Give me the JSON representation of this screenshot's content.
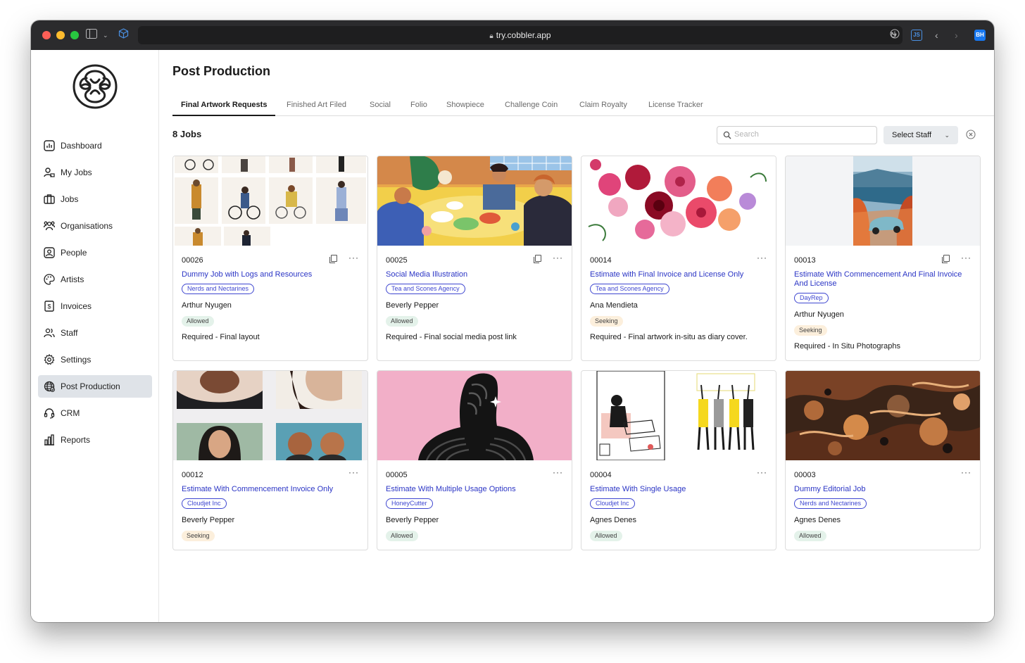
{
  "browser": {
    "url": "try.cobbler.app",
    "extension_js": "JS",
    "extension_bh": "BH"
  },
  "sidebar": {
    "items": [
      {
        "label": "Dashboard",
        "icon": "dashboard-icon"
      },
      {
        "label": "My Jobs",
        "icon": "user-jobs-icon"
      },
      {
        "label": "Jobs",
        "icon": "briefcase-icon"
      },
      {
        "label": "Organisations",
        "icon": "organisations-icon"
      },
      {
        "label": "People",
        "icon": "people-icon"
      },
      {
        "label": "Artists",
        "icon": "palette-icon"
      },
      {
        "label": "Invoices",
        "icon": "invoice-icon"
      },
      {
        "label": "Staff",
        "icon": "staff-icon"
      },
      {
        "label": "Settings",
        "icon": "gear-icon"
      },
      {
        "label": "Post Production",
        "icon": "globe-icon",
        "active": true
      },
      {
        "label": "CRM",
        "icon": "headset-icon"
      },
      {
        "label": "Reports",
        "icon": "bar-chart-icon"
      }
    ]
  },
  "main": {
    "title": "Post Production",
    "tabs": [
      {
        "label": "Final Artwork Requests",
        "active": true
      },
      {
        "label": "Finished Art Filed"
      },
      {
        "label": "Social"
      },
      {
        "label": "Folio"
      },
      {
        "label": "Showpiece"
      },
      {
        "label": "Challenge Coin"
      },
      {
        "label": "Claim Royalty"
      },
      {
        "label": "License Tracker"
      }
    ],
    "jobs_count": "8 Jobs",
    "search_placeholder": "Search",
    "select_staff_label": "Select Staff"
  },
  "cards": [
    {
      "number": "00026",
      "title": "Dummy Job with Logs and Resources",
      "org": "Nerds and Nectarines",
      "person": "Arthur Nyugen",
      "status": "Allowed",
      "requirement": "Required - Final layout",
      "image": "illustrated-figures-grid"
    },
    {
      "number": "00025",
      "title": "Social Media Illustration",
      "org": "Tea and Scones Agency",
      "person": "Beverly Pepper",
      "status": "Allowed",
      "requirement": "Required - Final social media post link",
      "image": "kitchen-dinner-illustration"
    },
    {
      "number": "00014",
      "title": "Estimate with Final Invoice and License Only",
      "org": "Tea and Scones Agency",
      "person": "Ana Mendieta",
      "status": "Seeking",
      "requirement": "Required - Final artwork in-situ as diary cover.",
      "image": "floral-bouquet"
    },
    {
      "number": "00013",
      "title": "Estimate With Commencement And Final Invoice And License",
      "org": "DayRep",
      "person": "Arthur Nyugen",
      "status": "Seeking",
      "requirement": "Required - In Situ Photographs",
      "image": "car-coastal-road"
    },
    {
      "number": "00012",
      "title": "Estimate With Commencement Invoice Only",
      "org": "Cloudjet Inc",
      "person": "Beverly Pepper",
      "status": "Seeking",
      "requirement": "",
      "image": "portrait-illustrations"
    },
    {
      "number": "00005",
      "title": "Estimate With Multiple Usage Options",
      "org": "HoneyCutter",
      "person": "Beverly Pepper",
      "status": "Allowed",
      "requirement": "",
      "image": "figure-pink-background"
    },
    {
      "number": "00004",
      "title": "Estimate With Single Usage",
      "org": "Cloudjet Inc",
      "person": "Agnes Denes",
      "status": "Allowed",
      "requirement": "",
      "image": "line-art-figures"
    },
    {
      "number": "00003",
      "title": "Dummy Editorial Job",
      "org": "Nerds and Nectarines",
      "person": "Agnes Denes",
      "status": "Allowed",
      "requirement": "",
      "image": "abstract-sculpture"
    }
  ],
  "colors": {
    "link": "#2b35c5",
    "tag_border": "#3e46d0",
    "allowed_bg": "#e4f2ea",
    "seeking_bg": "#fcefdc",
    "active_nav_bg": "#dfe3e8"
  }
}
